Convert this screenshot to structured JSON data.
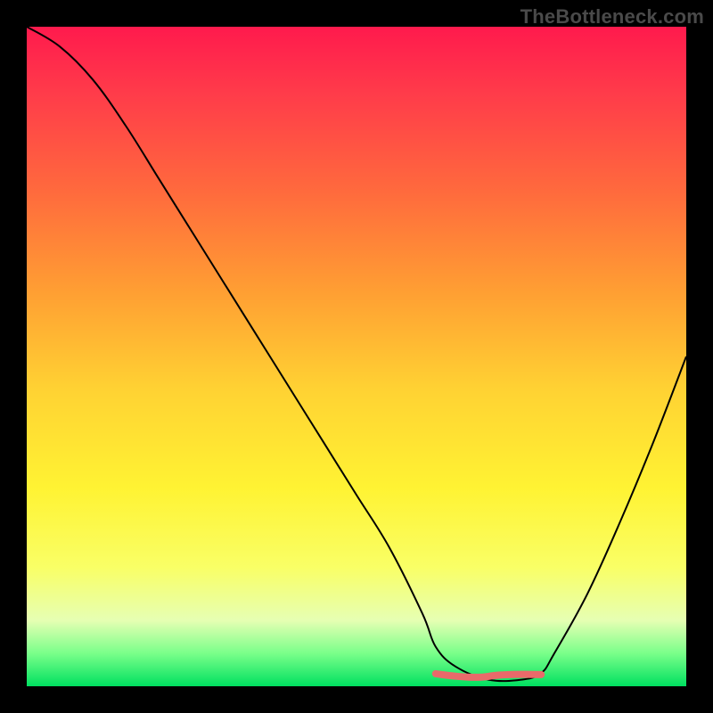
{
  "watermark": "TheBottleneck.com",
  "chart_data": {
    "type": "line",
    "title": "",
    "xlabel": "",
    "ylabel": "",
    "xlim": [
      0,
      100
    ],
    "ylim": [
      0,
      100
    ],
    "x": [
      0,
      5,
      10,
      15,
      20,
      25,
      30,
      35,
      40,
      45,
      50,
      55,
      60,
      62,
      65,
      70,
      75,
      78,
      80,
      85,
      90,
      95,
      100
    ],
    "values": [
      100,
      97,
      92,
      85,
      77,
      69,
      61,
      53,
      45,
      37,
      29,
      21,
      11,
      6,
      3,
      1,
      1,
      2,
      5,
      14,
      25,
      37,
      50
    ],
    "trough": {
      "x_start": 62,
      "x_end": 78,
      "y": 1.5
    },
    "colors": {
      "background_gradient_top": "#ff1a4d",
      "background_gradient_bottom": "#00e060",
      "curve": "#000000",
      "trough_highlight": "#e96a6a",
      "frame": "#000000"
    }
  }
}
